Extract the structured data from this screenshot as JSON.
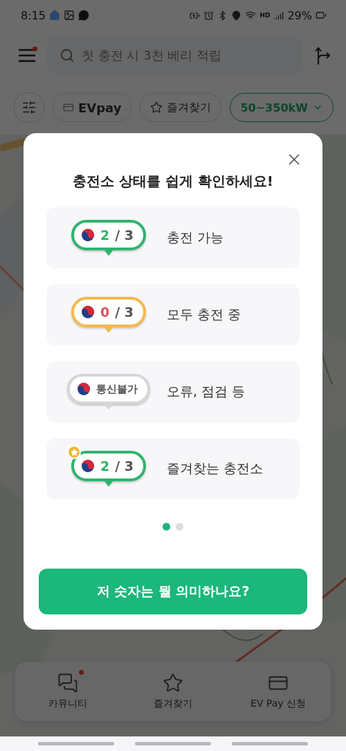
{
  "status_bar": {
    "time": "8:15",
    "hd_label": "HD",
    "battery": "29%"
  },
  "header": {
    "placeholder": "첫 충전 시 3천 베리 적립",
    "menu_badge": true
  },
  "filters": [
    {
      "kind": "settings",
      "selected": false
    },
    {
      "kind": "brand",
      "label": "EVpay",
      "selected": false
    },
    {
      "kind": "favorite",
      "label": "즐겨찾기",
      "selected": false
    },
    {
      "kind": "dropdown",
      "label": "50~350kW",
      "selected": true
    }
  ],
  "dialog": {
    "title": "충전소 상태를 쉽게 확인하세요!",
    "legend": [
      {
        "kind": "available",
        "count": "2",
        "total": "/ 3",
        "favorite": false,
        "label": "충전 가능"
      },
      {
        "kind": "busy",
        "count": "0",
        "total": "/ 3",
        "favorite": false,
        "label": "모두 충전 중"
      },
      {
        "kind": "offline",
        "text": "통신불가",
        "favorite": false,
        "label": "오류, 점검 등"
      },
      {
        "kind": "available",
        "count": "2",
        "total": "/ 3",
        "favorite": true,
        "label": "즐겨찾는 충전소"
      }
    ],
    "pages": [
      {
        "selected": true
      },
      {
        "selected": false
      }
    ],
    "action": "저 숫자는 뭘 의미하나요?"
  },
  "bottom_nav": [
    {
      "kind": "community",
      "label": "카뮤니티",
      "badge": true
    },
    {
      "kind": "favorites",
      "label": "즐겨찾기",
      "badge": false
    },
    {
      "kind": "evpay",
      "label": "EV Pay 신청",
      "badge": false
    }
  ]
}
